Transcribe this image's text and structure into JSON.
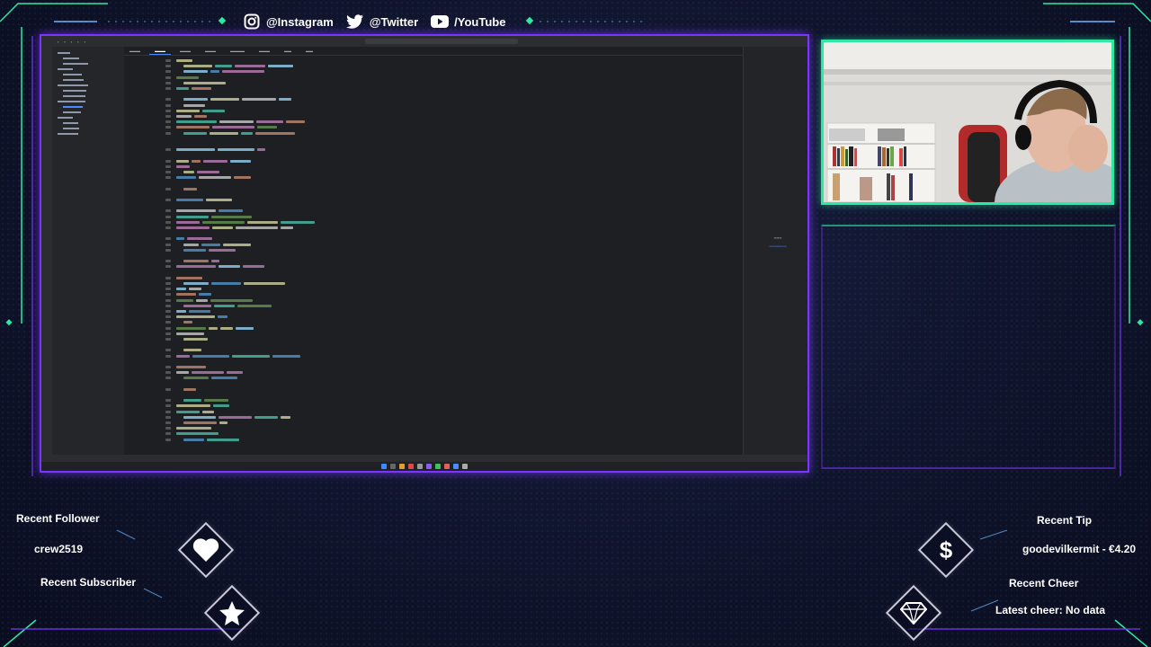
{
  "social": {
    "instagram": "@Instagram",
    "twitter": "@Twitter",
    "youtube": "/YouTube"
  },
  "colors": {
    "accent_purple": "#7a35ff",
    "accent_green": "#2fe9a3",
    "background": "#11162f"
  },
  "alerts": {
    "recent_follower_label": "Recent Follower",
    "recent_follower_value": "crew2519",
    "recent_subscriber_label": "Recent Subscriber",
    "recent_tip_label": "Recent Tip",
    "recent_tip_value": "goodevilkermit - €4.20",
    "recent_cheer_label": "Recent Cheer",
    "recent_cheer_value": "Latest cheer: No data"
  },
  "icons": {
    "follower": "heart-icon",
    "subscriber": "star-icon",
    "tip": "dollar-icon",
    "cheer": "gem-icon"
  }
}
